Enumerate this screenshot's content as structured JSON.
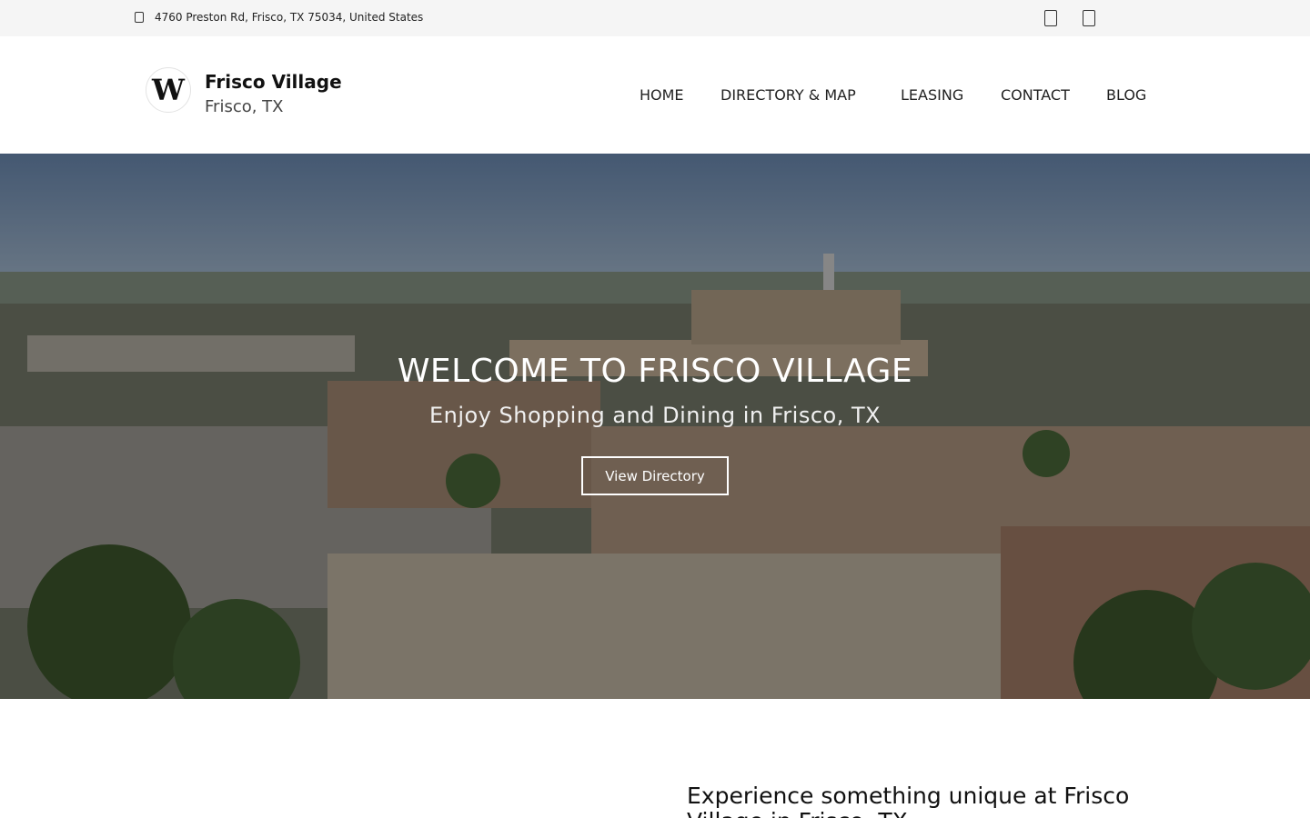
{
  "topbar": {
    "address": "4760 Preston Rd, Frisco, TX 75034, United States",
    "icons": [
      "location-pin-icon",
      "facebook-icon",
      "instagram-icon"
    ]
  },
  "brand": {
    "logo_letter": "W",
    "name": "Frisco Village",
    "location": "Frisco, TX"
  },
  "nav": {
    "items": [
      "HOME",
      "DIRECTORY & MAP",
      "LEASING",
      "CONTACT",
      "BLOG"
    ]
  },
  "hero": {
    "title": "WELCOME TO FRISCO VILLAGE",
    "subtitle": "Enjoy Shopping and Dining in Frisco, TX",
    "button_label": "View Directory"
  },
  "intro": {
    "heading": "Experience something unique at Frisco Village in Frisco, TX"
  },
  "colors": {
    "topbar_bg": "#f5f5f5",
    "text": "#111111",
    "hero_text": "#ffffff"
  }
}
